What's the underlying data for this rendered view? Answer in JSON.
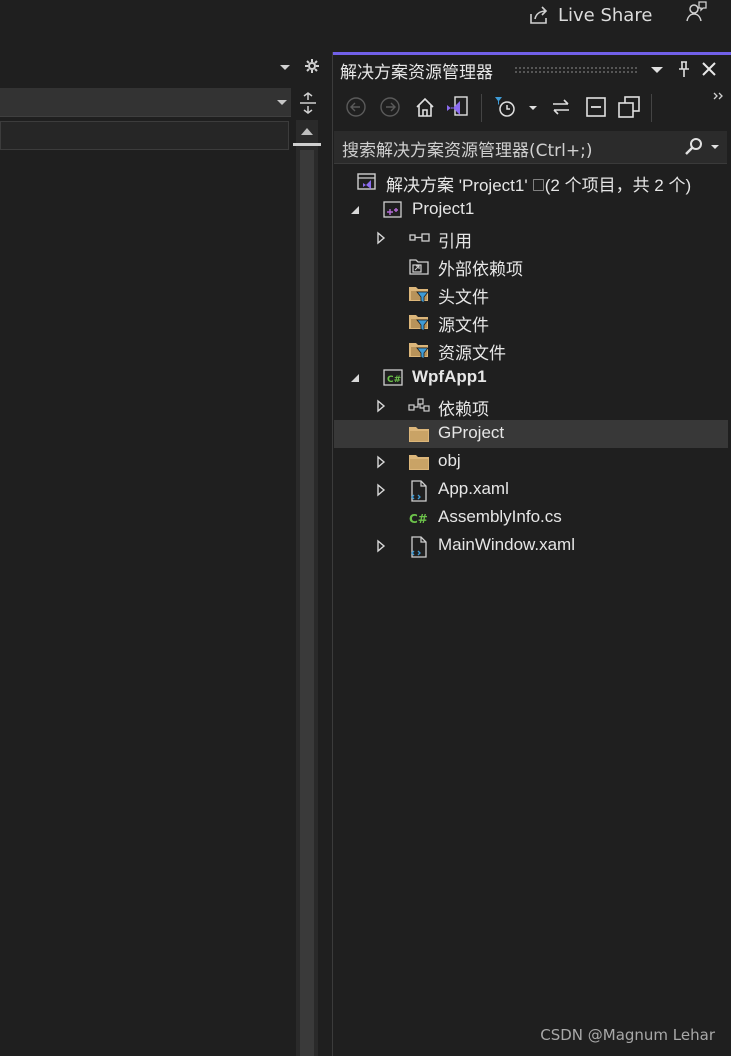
{
  "topbar": {
    "live_share": "Live Share"
  },
  "panel": {
    "title": "解决方案资源管理器",
    "search_placeholder": "搜索解决方案资源管理器(Ctrl+;)"
  },
  "tree": [
    {
      "label": "解决方案 'Project1' 🗆(2 个项目，共 2 个)",
      "icon": "solution-icon",
      "expander": "none"
    },
    {
      "label": "Project1",
      "icon": "cpp-project-icon",
      "expander": "expanded"
    },
    {
      "label": "引用",
      "icon": "references-icon",
      "expander": "collapsed"
    },
    {
      "label": "外部依赖项",
      "icon": "external-deps-icon",
      "expander": "none"
    },
    {
      "label": "头文件",
      "icon": "filter-folder-icon",
      "expander": "none"
    },
    {
      "label": "源文件",
      "icon": "filter-folder-icon",
      "expander": "none"
    },
    {
      "label": "资源文件",
      "icon": "filter-folder-icon",
      "expander": "none"
    },
    {
      "label": "WpfApp1",
      "icon": "csharp-project-icon",
      "expander": "expanded",
      "bold": true
    },
    {
      "label": "依赖项",
      "icon": "dependencies-icon",
      "expander": "collapsed"
    },
    {
      "label": "GProject",
      "icon": "folder-icon",
      "expander": "none",
      "selected": true
    },
    {
      "label": "obj",
      "icon": "folder-icon",
      "expander": "collapsed"
    },
    {
      "label": "App.xaml",
      "icon": "xaml-file-icon",
      "expander": "collapsed"
    },
    {
      "label": "AssemblyInfo.cs",
      "icon": "csharp-file-icon",
      "expander": "none"
    },
    {
      "label": "MainWindow.xaml",
      "icon": "xaml-file-icon",
      "expander": "collapsed"
    }
  ],
  "watermark": "CSDN @Magnum Lehar",
  "colors": {
    "accent": "#7160e8",
    "background": "#1f1f1f",
    "selection": "#383838",
    "folder": "#dcb67a",
    "filter": "#3e9bd6"
  }
}
